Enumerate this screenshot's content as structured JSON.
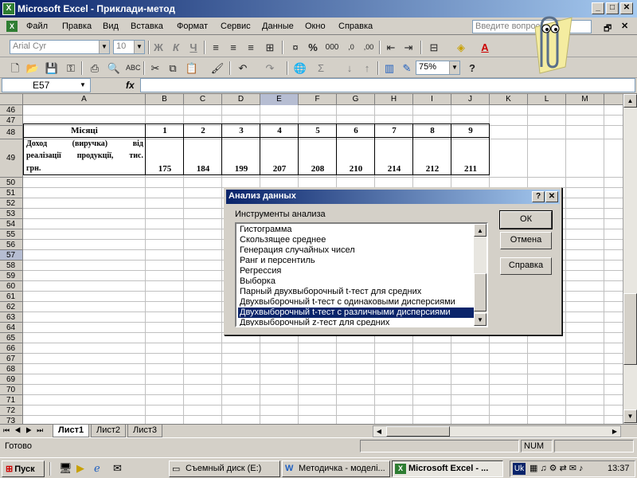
{
  "window": {
    "title": "Microsoft Excel - Приклади-метод",
    "app_icon": "X"
  },
  "menu": {
    "items": [
      "Файл",
      "Правка",
      "Вид",
      "Вставка",
      "Формат",
      "Сервис",
      "Данные",
      "Окно",
      "Справка"
    ],
    "question_placeholder": "Введите вопрос"
  },
  "toolbar": {
    "font_name": "Arial Cyr",
    "font_size": "10",
    "bold": "Ж",
    "italic": "К",
    "underline": "Ч",
    "percent": "%",
    "thousands": "000",
    "zoom": "75%"
  },
  "formula_bar": {
    "name_box": "E57",
    "fx": "fx",
    "value": ""
  },
  "grid": {
    "columns": [
      "A",
      "B",
      "C",
      "D",
      "E",
      "F",
      "G",
      "H",
      "I",
      "J",
      "K",
      "L",
      "M"
    ],
    "selected_column": "E",
    "rows": [
      "46",
      "47",
      "48",
      "49",
      "50",
      "51",
      "52",
      "53",
      "54",
      "55",
      "56",
      "57",
      "58",
      "59",
      "60",
      "61",
      "62",
      "63",
      "64",
      "65",
      "66",
      "67",
      "68",
      "69",
      "70",
      "71",
      "72",
      "73"
    ],
    "selected_row": "57"
  },
  "table": {
    "header_label": "Місяці",
    "months": [
      "1",
      "2",
      "3",
      "4",
      "5",
      "6",
      "7",
      "8",
      "9"
    ],
    "row_label_line1": "Доход (виручка) від",
    "row_label_line2": "реалізації продукції, тис.",
    "row_label_line3": "грн.",
    "values": [
      "175",
      "184",
      "199",
      "207",
      "208",
      "210",
      "214",
      "212",
      "211"
    ]
  },
  "sheets": {
    "tabs": [
      "Лист1",
      "Лист2",
      "Лист3"
    ],
    "active": "Лист1"
  },
  "status": {
    "text": "Готово",
    "num": "NUM"
  },
  "dialog": {
    "title": "Анализ данных",
    "help_glyph": "?",
    "close_glyph": "✕",
    "label": "Инструменты анализа",
    "items": [
      "Гистограмма",
      "Скользящее среднее",
      "Генерация случайных чисел",
      "Ранг и персентиль",
      "Регрессия",
      "Выборка",
      "Парный двухвыборочный t-тест для средних",
      "Двухвыборочный t-тест с одинаковыми дисперсиями",
      "Двухвыборочный t-тест с различными дисперсиями",
      "Двухвыборочный z-тест для средних"
    ],
    "selected_index": 8,
    "ok": "ОК",
    "cancel": "Отмена",
    "help": "Справка"
  },
  "taskbar": {
    "start": "Пуск",
    "tasks": [
      "Съемный диск (E:)",
      "Методичка - моделі...",
      "Microsoft Excel - ..."
    ],
    "active_task": 2,
    "lang": "Uk",
    "time": "13:37"
  }
}
